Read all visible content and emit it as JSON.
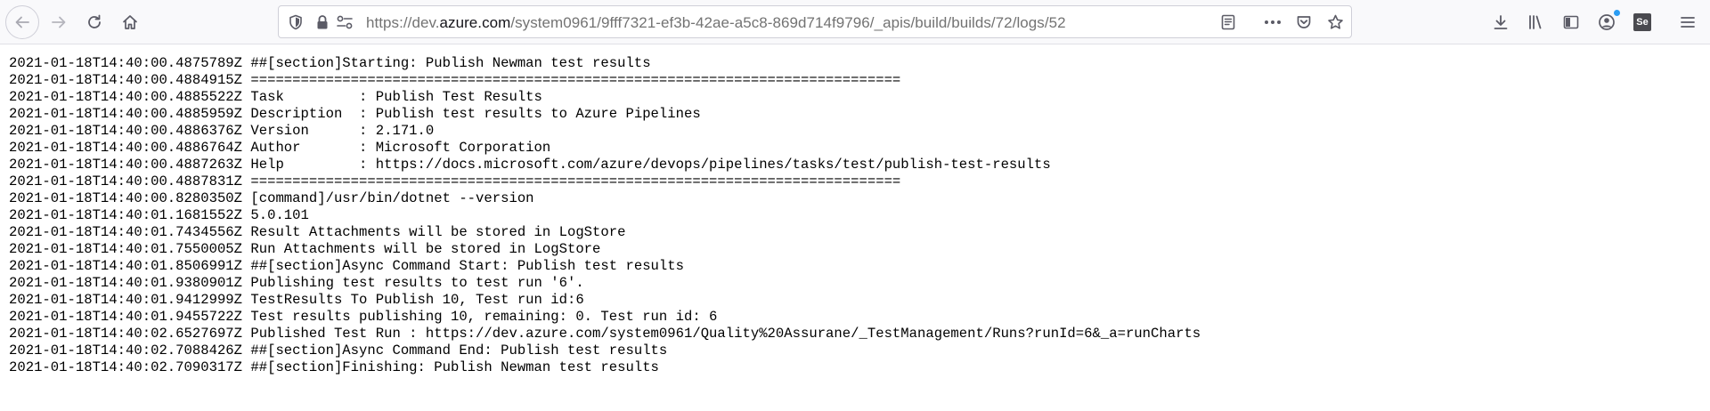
{
  "browser": {
    "url": {
      "scheme": "https://",
      "subdomain": "dev.",
      "domain": "azure.com",
      "path": "/system0961/9fff7321-ef3b-42ae-a5c8-869d714f9796/_apis/build/builds/72/logs/52"
    },
    "icons": {
      "back": "back-arrow-icon",
      "forward": "forward-arrow-icon",
      "reload": "reload-icon",
      "home": "home-icon",
      "tracking": "tracking-protection-shield-icon",
      "lock": "lock-icon",
      "permissions": "permissions-icon",
      "reader": "reader-view-icon",
      "more": "page-actions-more-icon",
      "pocket": "pocket-icon",
      "bookmark": "bookmark-star-icon",
      "downloads": "downloads-icon",
      "library": "library-icon",
      "sidebar": "sidebar-icon",
      "account": "account-icon",
      "selenium": "selenium-extension-icon",
      "menu": "hamburger-menu-icon"
    },
    "selenium_label": "Se",
    "accent_color": "#2a9df4"
  },
  "log": {
    "lines": [
      "2021-01-18T14:40:00.4875789Z ##[section]Starting: Publish Newman test results",
      "2021-01-18T14:40:00.4884915Z ==============================================================================",
      "2021-01-18T14:40:00.4885522Z Task         : Publish Test Results",
      "2021-01-18T14:40:00.4885959Z Description  : Publish test results to Azure Pipelines",
      "2021-01-18T14:40:00.4886376Z Version      : 2.171.0",
      "2021-01-18T14:40:00.4886764Z Author       : Microsoft Corporation",
      "2021-01-18T14:40:00.4887263Z Help         : https://docs.microsoft.com/azure/devops/pipelines/tasks/test/publish-test-results",
      "2021-01-18T14:40:00.4887831Z ==============================================================================",
      "2021-01-18T14:40:00.8280350Z [command]/usr/bin/dotnet --version",
      "2021-01-18T14:40:01.1681552Z 5.0.101",
      "2021-01-18T14:40:01.7434556Z Result Attachments will be stored in LogStore",
      "2021-01-18T14:40:01.7550005Z Run Attachments will be stored in LogStore",
      "2021-01-18T14:40:01.8506991Z ##[section]Async Command Start: Publish test results",
      "2021-01-18T14:40:01.9380901Z Publishing test results to test run '6'.",
      "2021-01-18T14:40:01.9412999Z TestResults To Publish 10, Test run id:6",
      "2021-01-18T14:40:01.9455722Z Test results publishing 10, remaining: 0. Test run id: 6",
      "2021-01-18T14:40:02.6527697Z Published Test Run : https://dev.azure.com/system0961/Quality%20Assurane/_TestManagement/Runs?runId=6&_a=runCharts",
      "2021-01-18T14:40:02.7088426Z ##[section]Async Command End: Publish test results",
      "2021-01-18T14:40:02.7090317Z ##[section]Finishing: Publish Newman test results"
    ]
  }
}
